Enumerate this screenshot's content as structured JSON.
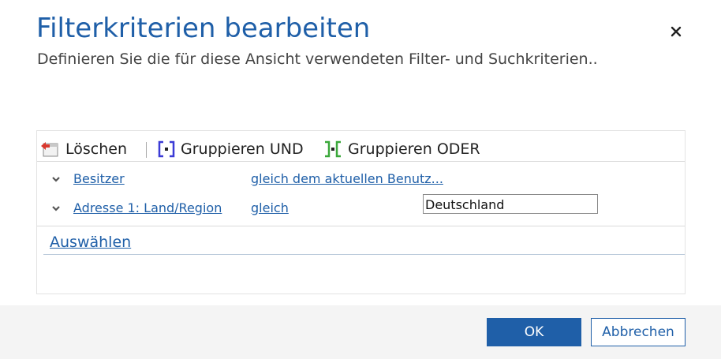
{
  "dialog": {
    "title": "Filterkriterien bearbeiten",
    "subtitle": "Definieren Sie die für diese Ansicht verwendeten Filter- und Suchkriterien..",
    "close_icon": "close-icon"
  },
  "toolbar": {
    "delete_label": "Löschen",
    "delete_icon": "delete-icon",
    "group_and_label": "Gruppieren UND",
    "group_and_icon": "group-and-icon",
    "group_or_label": "Gruppieren ODER",
    "group_or_icon": "group-or-icon"
  },
  "conditions": [
    {
      "field": "Besitzer",
      "operator": "gleich dem aktuellen Benutz...",
      "value": ""
    },
    {
      "field": "Adresse 1: Land/Region",
      "operator": "gleich",
      "value": "Deutschland"
    }
  ],
  "select_label": "Auswählen",
  "footer": {
    "ok_label": "OK",
    "cancel_label": "Abbrechen"
  },
  "colors": {
    "accent": "#1f5fa8",
    "group_and": "#3b3bd6",
    "group_or": "#3aa83a",
    "delete": "#d9382e"
  }
}
